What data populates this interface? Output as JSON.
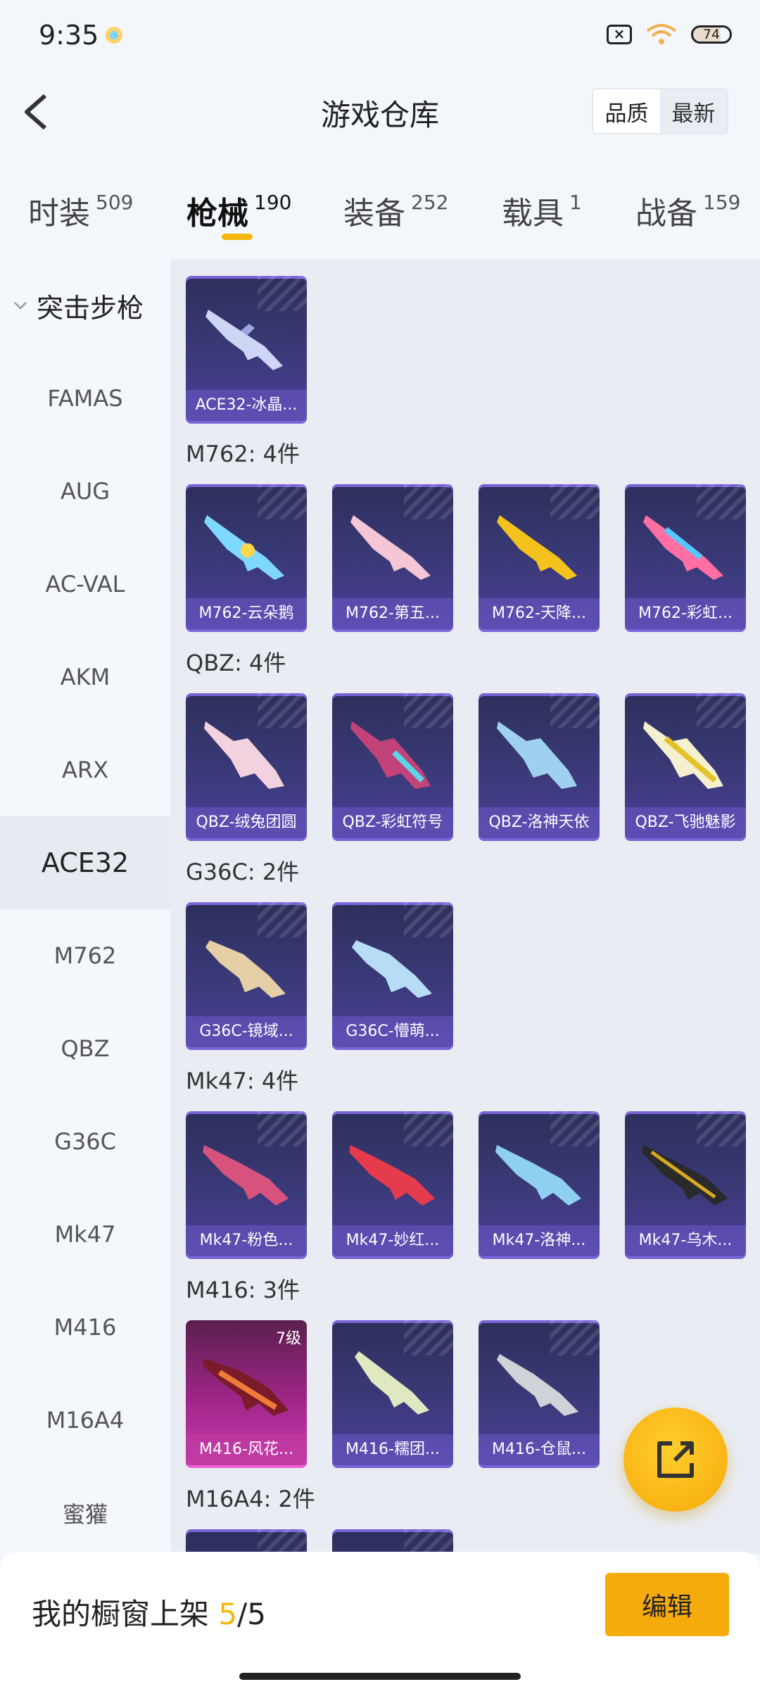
{
  "status": {
    "time": "9:35",
    "battery": "74",
    "signal": "6"
  },
  "header": {
    "title": "游戏仓库",
    "sort_options": [
      "品质",
      "最新"
    ]
  },
  "tabs": [
    {
      "label": "时装",
      "count": "509"
    },
    {
      "label": "枪械",
      "count": "190"
    },
    {
      "label": "装备",
      "count": "252"
    },
    {
      "label": "载具",
      "count": "1"
    },
    {
      "label": "战备",
      "count": "159"
    }
  ],
  "sidebar": {
    "group": "突击步枪",
    "items": [
      "FAMAS",
      "AUG",
      "AC-VAL",
      "AKM",
      "ARX",
      "ACE32",
      "M762",
      "QBZ",
      "G36C",
      "Mk47",
      "M416",
      "M16A4",
      "蜜獾"
    ],
    "active": "ACE32"
  },
  "content": {
    "top_item": {
      "name": "ACE32-冰晶..."
    },
    "sections": [
      {
        "title": "M762: 4件",
        "items": [
          "M762-云朵鹅",
          "M762-第五...",
          "M762-天降...",
          "M762-彩虹..."
        ]
      },
      {
        "title": "QBZ: 4件",
        "items": [
          "QBZ-绒兔团圆",
          "QBZ-彩虹符号",
          "QBZ-洛神天依",
          "QBZ-飞驰魅影"
        ]
      },
      {
        "title": "G36C: 2件",
        "items": [
          "G36C-镜域...",
          "G36C-懵萌..."
        ]
      },
      {
        "title": "Mk47: 4件",
        "items": [
          "Mk47-粉色...",
          "Mk47-妙红...",
          "Mk47-洛神...",
          "Mk47-乌木..."
        ]
      },
      {
        "title": "M416: 3件",
        "items": [
          "M416-风花...",
          "M416-糯团...",
          "M416-仓鼠..."
        ],
        "first_level": "7级"
      },
      {
        "title": "M16A4: 2件",
        "items": [
          "",
          ""
        ]
      }
    ]
  },
  "bottom": {
    "label": "我的橱窗上架",
    "count_current": "5",
    "count_total": "/5",
    "edit": "编辑"
  }
}
